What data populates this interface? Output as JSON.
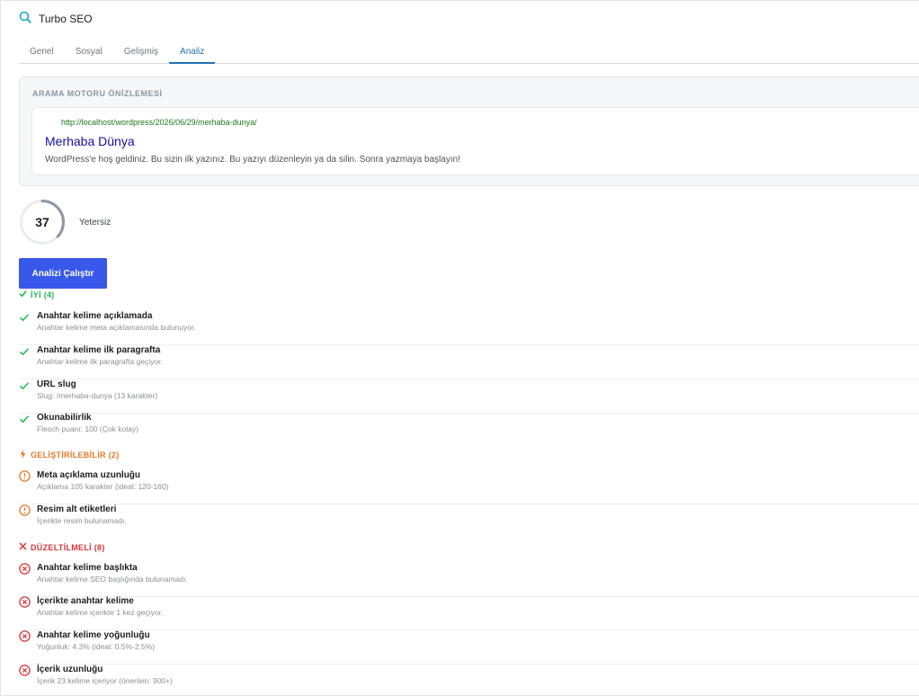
{
  "header": {
    "title": "Turbo SEO",
    "icon": "search-icon"
  },
  "tabs": [
    {
      "label": "Genel",
      "active": false
    },
    {
      "label": "Sosyal",
      "active": false
    },
    {
      "label": "Gelişmiş",
      "active": false
    },
    {
      "label": "Analiz",
      "active": true
    }
  ],
  "preview": {
    "label": "ARAMA MOTORU ÖNİZLEMESİ",
    "url": "http://localhost/wordpress/2026/06/29/merhaba-dunya/",
    "title": "Merhaba Dünya",
    "description": "WordPress'e hoş geldiniz. Bu sizin ilk yazınız. Bu yazıyı düzenleyin ya da silin. Sonra yazmaya başlayın!"
  },
  "score": {
    "value": "37",
    "max": 100,
    "label": "Yetersiz"
  },
  "run_button": "Analizi Çalıştır",
  "colors": {
    "good": "#1db954",
    "improve": "#e6782a",
    "bad": "#d63638",
    "accent": "#3858e9"
  },
  "groups": {
    "good": {
      "title": "İYİ (4)",
      "items": [
        {
          "title": "Anahtar kelime açıklamada",
          "desc": "Anahtar kelime meta açıklamasında bulunuyor."
        },
        {
          "title": "Anahtar kelime ilk paragrafta",
          "desc": "Anahtar kelime ilk paragrafta geçiyor."
        },
        {
          "title": "URL slug",
          "desc": "Slug: /merhaba-dunya (13 karakter)"
        },
        {
          "title": "Okunabilirlik",
          "desc": "Flesch puanı: 100 (Çok kolay)"
        }
      ]
    },
    "improve": {
      "title": "GELİŞTİRİLEBİLİR (2)",
      "items": [
        {
          "title": "Meta açıklama uzunluğu",
          "desc": "Açıklama 105 karakter (ideal: 120-160)"
        },
        {
          "title": "Resim alt etiketleri",
          "desc": "İçerikte resim bulunamadı."
        }
      ]
    },
    "bad": {
      "title": "DÜZELTİLMELİ (8)",
      "items": [
        {
          "title": "Anahtar kelime başlıkta",
          "desc": "Anahtar kelime SEO başlığında bulunamadı."
        },
        {
          "title": "İçerikte anahtar kelime",
          "desc": "Anahtar kelime içerikte 1 kez geçiyor."
        },
        {
          "title": "Anahtar kelime yoğunluğu",
          "desc": "Yoğunluk: 4.3% (ideal: 0.5%-2.5%)"
        },
        {
          "title": "İçerik uzunluğu",
          "desc": "İçerik 23 kelime içeriyor (önerilen: 900+)"
        }
      ]
    }
  }
}
